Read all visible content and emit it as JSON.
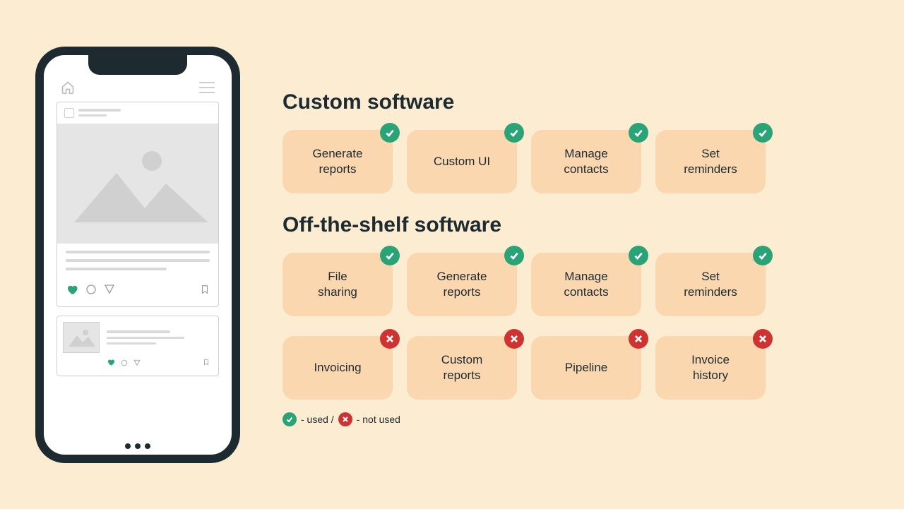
{
  "sections": {
    "custom": {
      "title": "Custom software"
    },
    "ots": {
      "title": "Off-the-shelf software"
    }
  },
  "custom": [
    {
      "label": "Generate\nreports",
      "used": true
    },
    {
      "label": "Custom UI",
      "used": true
    },
    {
      "label": "Manage\ncontacts",
      "used": true
    },
    {
      "label": "Set\nreminders",
      "used": true
    }
  ],
  "ots_used": [
    {
      "label": "File\nsharing",
      "used": true
    },
    {
      "label": "Generate\nreports",
      "used": true
    },
    {
      "label": "Manage\ncontacts",
      "used": true
    },
    {
      "label": "Set\nreminders",
      "used": true
    }
  ],
  "ots_notused": [
    {
      "label": "Invoicing",
      "used": false
    },
    {
      "label": "Custom\nreports",
      "used": false
    },
    {
      "label": "Pipeline",
      "used": false
    },
    {
      "label": "Invoice\nhistory",
      "used": false
    }
  ],
  "legend": {
    "used": "- used /",
    "notused": "- not used"
  }
}
